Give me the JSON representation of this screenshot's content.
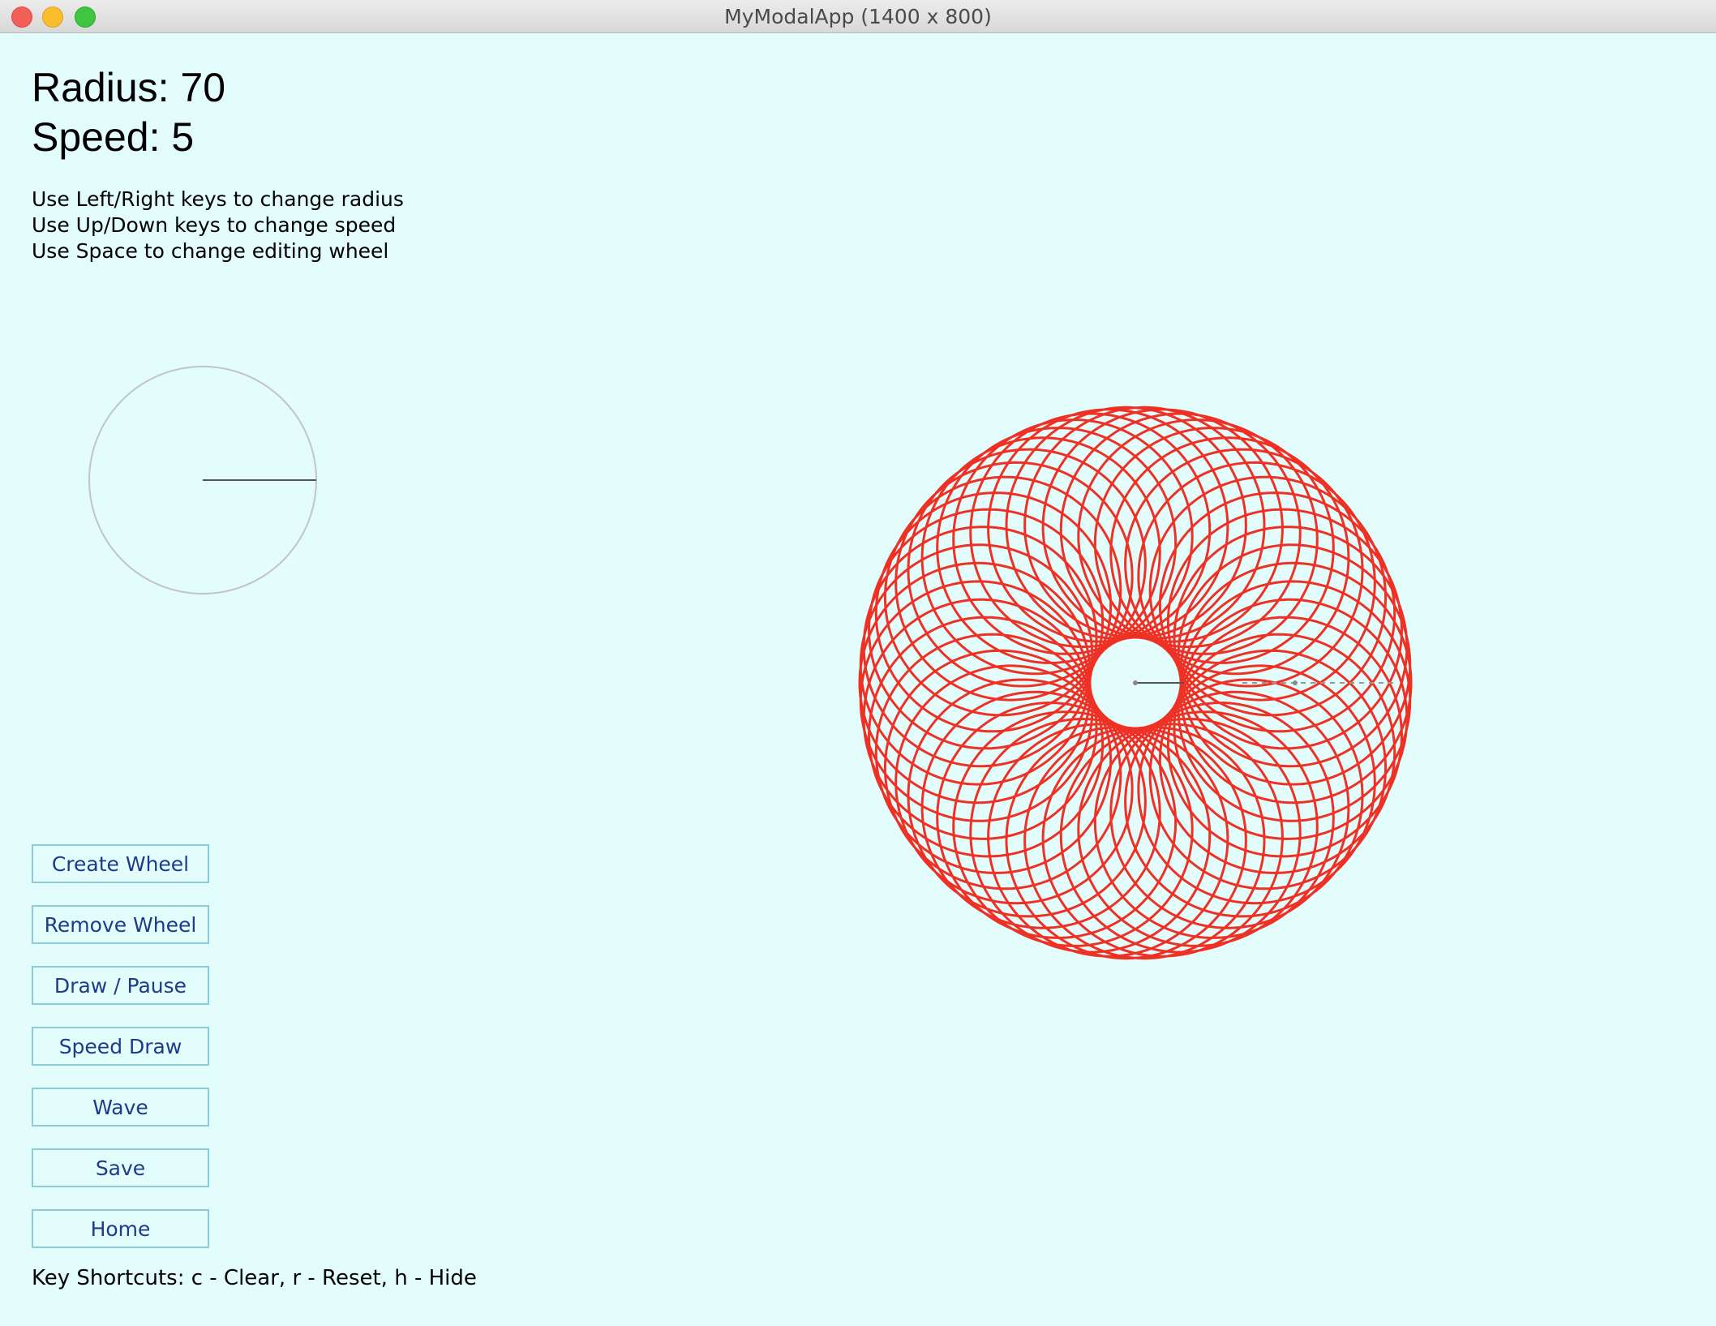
{
  "window": {
    "title": "MyModalApp (1400 x 800)"
  },
  "status": {
    "radius_label": "Radius: 70",
    "speed_label": "Speed: 5"
  },
  "instructions": [
    "Use Left/Right keys to change radius",
    "Use Up/Down keys to change speed",
    "Use Space to change editing wheel"
  ],
  "buttons": [
    "Create Wheel",
    "Remove Wheel",
    "Draw / Pause",
    "Speed Draw",
    "Wave",
    "Save",
    "Home"
  ],
  "footer": {
    "shortcuts": "Key Shortcuts: c - Clear, r - Reset, h - Hide"
  },
  "colors": {
    "background": "#e3fdfd",
    "pattern": "#ee3124",
    "button_border": "#8ccadc",
    "button_text": "#1e3a8a"
  }
}
